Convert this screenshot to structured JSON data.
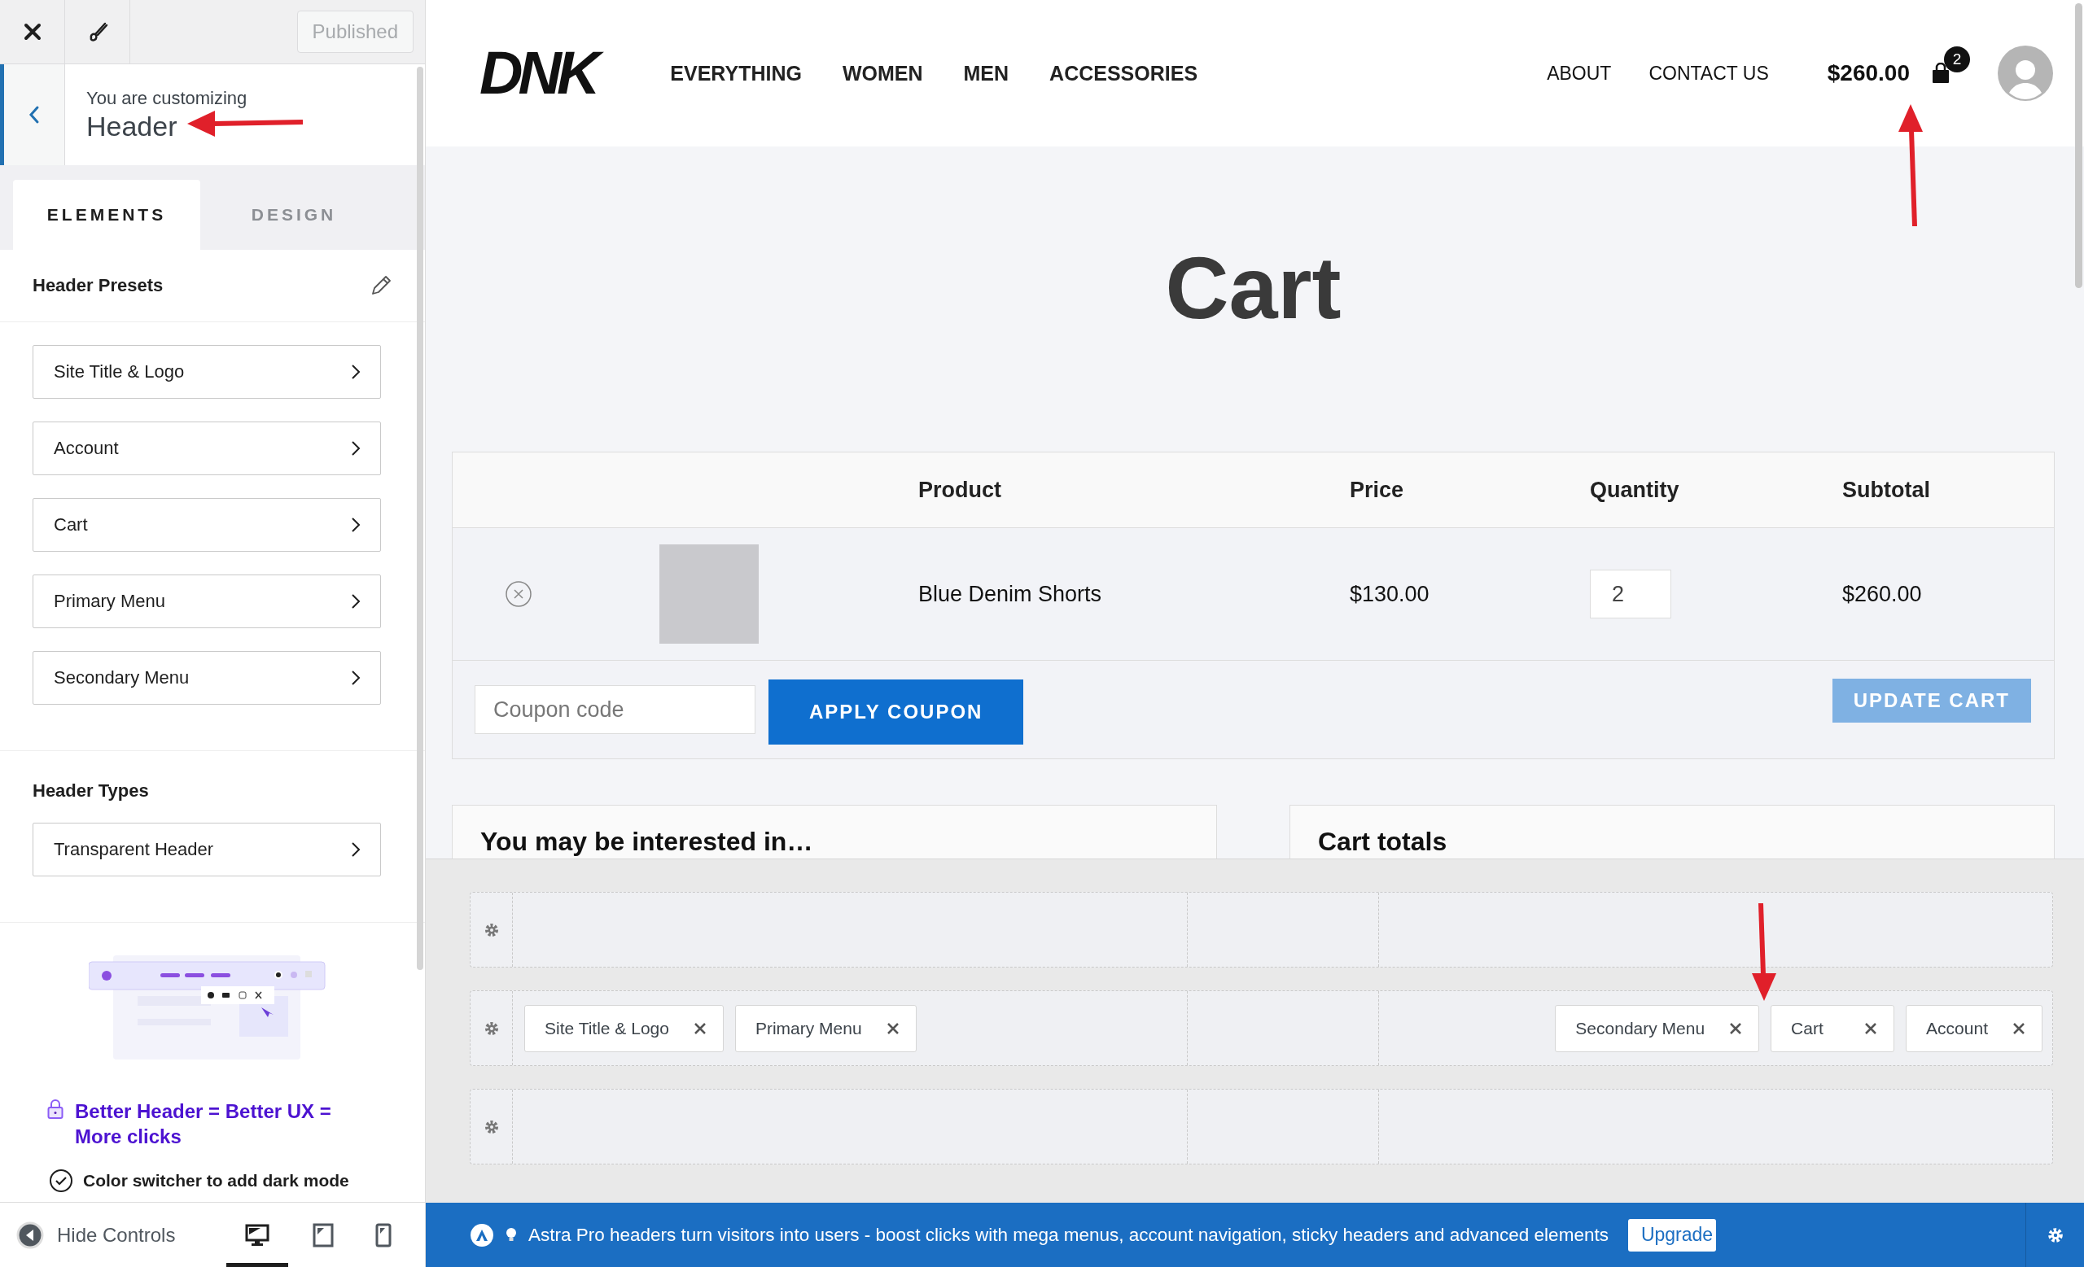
{
  "toolbar": {
    "publish_button": "Published"
  },
  "customizing": {
    "caption": "You are customizing",
    "title": "Header"
  },
  "tabs": [
    {
      "label": "ELEMENTS",
      "selected": true
    },
    {
      "label": "DESIGN",
      "selected": false
    }
  ],
  "presets": {
    "title": "Header Presets",
    "items": [
      "Site Title & Logo",
      "Account",
      "Cart",
      "Primary Menu",
      "Secondary Menu"
    ]
  },
  "types": {
    "title": "Header Types",
    "items": [
      "Transparent Header"
    ]
  },
  "promo": {
    "link": "Better Header = Better UX = More clicks",
    "feature": "Color switcher to add dark mode"
  },
  "footer": {
    "hide_controls": "Hide Controls",
    "devices": [
      {
        "kind": "desktop",
        "selected": true
      },
      {
        "kind": "tablet",
        "selected": false
      },
      {
        "kind": "mobile",
        "selected": false
      }
    ]
  },
  "site": {
    "logo": "DNK",
    "nav": [
      "EVERYTHING",
      "WOMEN",
      "MEN",
      "ACCESSORIES"
    ],
    "secondary_nav": [
      "ABOUT",
      "CONTACT US"
    ],
    "cart_total": "$260.00",
    "cart_count": "2"
  },
  "page_title": "Cart",
  "table": {
    "columns": [
      "Product",
      "Price",
      "Quantity",
      "Subtotal"
    ],
    "rows": [
      {
        "product": "Blue Denim Shorts",
        "price": "$130.00",
        "quantity": "2",
        "subtotal": "$260.00"
      }
    ]
  },
  "coupon": {
    "placeholder": "Coupon code",
    "apply": {
      "label": "APPLY COUPON",
      "disabled": false
    },
    "update": {
      "label": "UPDATE CART",
      "disabled": true
    }
  },
  "cards": [
    "You may be interested in…",
    "Cart totals"
  ],
  "builder": {
    "rows": [
      {},
      {
        "left": [
          "Site Title & Logo",
          "Primary Menu"
        ],
        "right": [
          "Secondary Menu",
          "Cart",
          "Account"
        ]
      },
      {}
    ]
  },
  "notice": {
    "text": "Astra Pro headers turn visitors into users - boost clicks with mega menus, account navigation, sticky headers and advanced elements",
    "button": "Upgrade"
  }
}
